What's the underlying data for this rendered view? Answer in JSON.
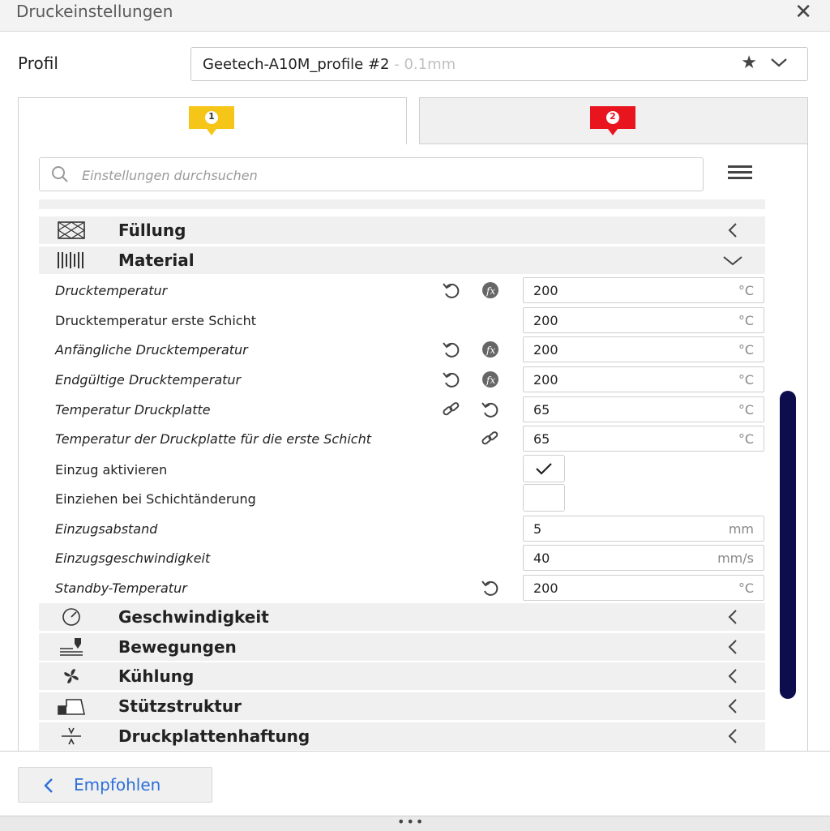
{
  "window": {
    "title": "Druckeinstellungen",
    "close_icon": "close-icon"
  },
  "profile": {
    "label": "Profil",
    "name": "Geetech-A10M_profile #2",
    "subtitle": " - 0.1mm"
  },
  "tabs": [
    {
      "number": "1",
      "color": "#f5c518"
    },
    {
      "number": "2",
      "color": "#e8141e"
    }
  ],
  "search": {
    "placeholder": "Einstellungen durchsuchen"
  },
  "categories": {
    "fuellung": "Füllung",
    "material": "Material",
    "geschwindigkeit": "Geschwindigkeit",
    "bewegungen": "Bewegungen",
    "kuehlung": "Kühlung",
    "stuetzstruktur": "Stützstruktur",
    "druckplattenhaftung": "Druckplattenhaftung"
  },
  "settings": [
    {
      "label": "Drucktemperatur",
      "value": "200",
      "unit": "°C"
    },
    {
      "label": "Drucktemperatur erste Schicht",
      "value": "200",
      "unit": "°C"
    },
    {
      "label": "Anfängliche Drucktemperatur",
      "value": "200",
      "unit": "°C"
    },
    {
      "label": "Endgültige Drucktemperatur",
      "value": "200",
      "unit": "°C"
    },
    {
      "label": "Temperatur Druckplatte",
      "value": "65",
      "unit": "°C"
    },
    {
      "label": "Temperatur der Druckplatte für die erste Schicht",
      "value": "65",
      "unit": "°C"
    },
    {
      "label": "Einzug aktivieren",
      "checked": true
    },
    {
      "label": "Einziehen bei Schichtänderung",
      "checked": false
    },
    {
      "label": "Einzugsabstand",
      "value": "5",
      "unit": "mm"
    },
    {
      "label": "Einzugsgeschwindigkeit",
      "value": "40",
      "unit": "mm/s"
    },
    {
      "label": "Standby-Temperatur",
      "value": "200",
      "unit": "°C"
    }
  ],
  "footer": {
    "recommended_label": "Empfohlen"
  },
  "colors": {
    "scrollbar": "#0d0d4e",
    "link_blue": "#2c6fd9"
  }
}
